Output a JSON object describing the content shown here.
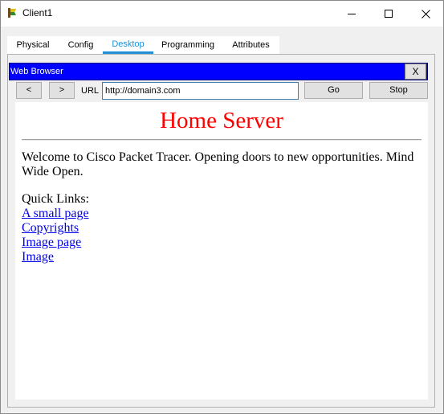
{
  "window": {
    "title": "Client1"
  },
  "tabs": [
    {
      "label": "Physical"
    },
    {
      "label": "Config"
    },
    {
      "label": "Desktop"
    },
    {
      "label": "Programming"
    },
    {
      "label": "Attributes"
    }
  ],
  "active_tab": "Desktop",
  "browser": {
    "title": "Web Browser",
    "close_label": "X",
    "back_label": "<",
    "forward_label": ">",
    "url_label": "URL",
    "url_value": "http://domain3.com",
    "go_label": "Go",
    "stop_label": "Stop"
  },
  "page": {
    "heading": "Home Server",
    "heading_color": "#ff0000",
    "welcome_text": "Welcome to Cisco Packet Tracer. Opening doors to new opportunities. Mind Wide Open.",
    "quick_links_label": "Quick Links:",
    "links": [
      {
        "label": "A small page"
      },
      {
        "label": "Copyrights"
      },
      {
        "label": "Image page"
      },
      {
        "label": "Image"
      }
    ]
  },
  "colors": {
    "browser_bar": "#0000ff",
    "active_tab": "#1e90d8",
    "link": "#0000ee"
  }
}
